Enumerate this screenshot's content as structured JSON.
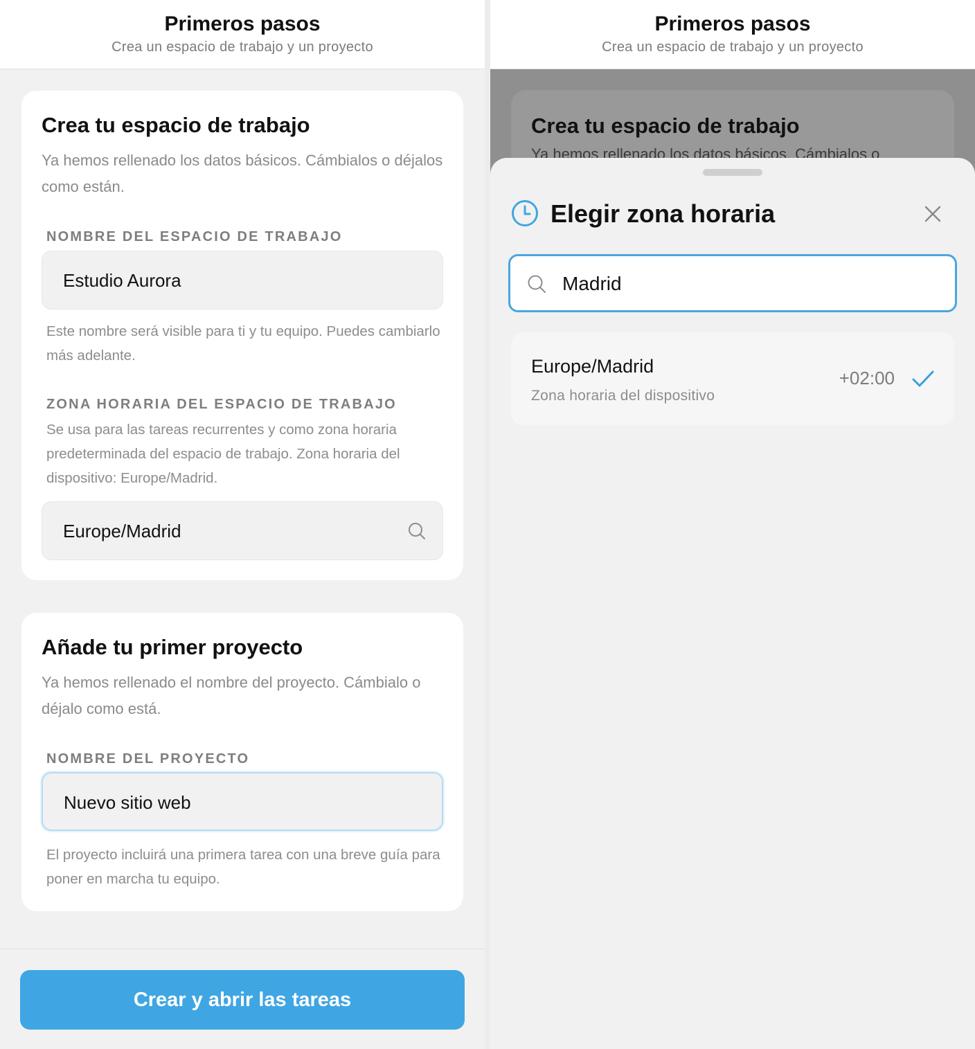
{
  "left_screen": {
    "header": {
      "title": "Primeros pasos",
      "subtitle": "Crea un espacio de trabajo y un proyecto"
    },
    "workspace_card": {
      "title": "Crea tu espacio de trabajo",
      "description": "Ya hemos rellenado los datos básicos. Cámbialos o déjalos como están.",
      "name_field": {
        "label": "NOMBRE DEL ESPACIO DE TRABAJO",
        "value": "Estudio Aurora",
        "help": "Este nombre será visible para ti y tu equipo. Puedes cambiarlo más adelante."
      },
      "timezone_field": {
        "label": "ZONA HORARIA DEL ESPACIO DE TRABAJO",
        "help": "Se usa para las tareas recurrentes y como zona horaria predeterminada del espacio de trabajo. Zona horaria del dispositivo: Europe/Madrid.",
        "value": "Europe/Madrid",
        "icon": "search-icon"
      }
    },
    "project_card": {
      "title": "Añade tu primer proyecto",
      "description": "Ya hemos rellenado el nombre del proyecto. Cámbialo o déjalo como está.",
      "name_field": {
        "label": "NOMBRE DEL PROYECTO",
        "value": "Nuevo sitio web",
        "help": "El proyecto incluirá una primera tarea con una breve guía para poner en marcha tu equipo."
      }
    },
    "footer": {
      "primary_button": "Crear y abrir las tareas"
    }
  },
  "right_screen": {
    "header": {
      "title": "Primeros pasos",
      "subtitle": "Crea un espacio de trabajo y un proyecto"
    },
    "background_card_title": "Crea tu espacio de trabajo",
    "background_card_desc": "Ya hemos rellenado los datos básicos. Cámbialos o",
    "sheet": {
      "title": "Elegir zona horaria",
      "title_icon": "clock-icon",
      "close_icon": "close-icon",
      "search": {
        "value": "Madrid",
        "icon": "search-icon"
      },
      "results": [
        {
          "name": "Europe/Madrid",
          "subtitle": "Zona horaria del dispositivo",
          "offset": "+02:00",
          "selected": true
        }
      ]
    }
  },
  "colors": {
    "accent": "#3fa6e3",
    "focus_border": "#4aa6df",
    "check": "#3a9fdc",
    "scrim": "#8f8f8f"
  }
}
